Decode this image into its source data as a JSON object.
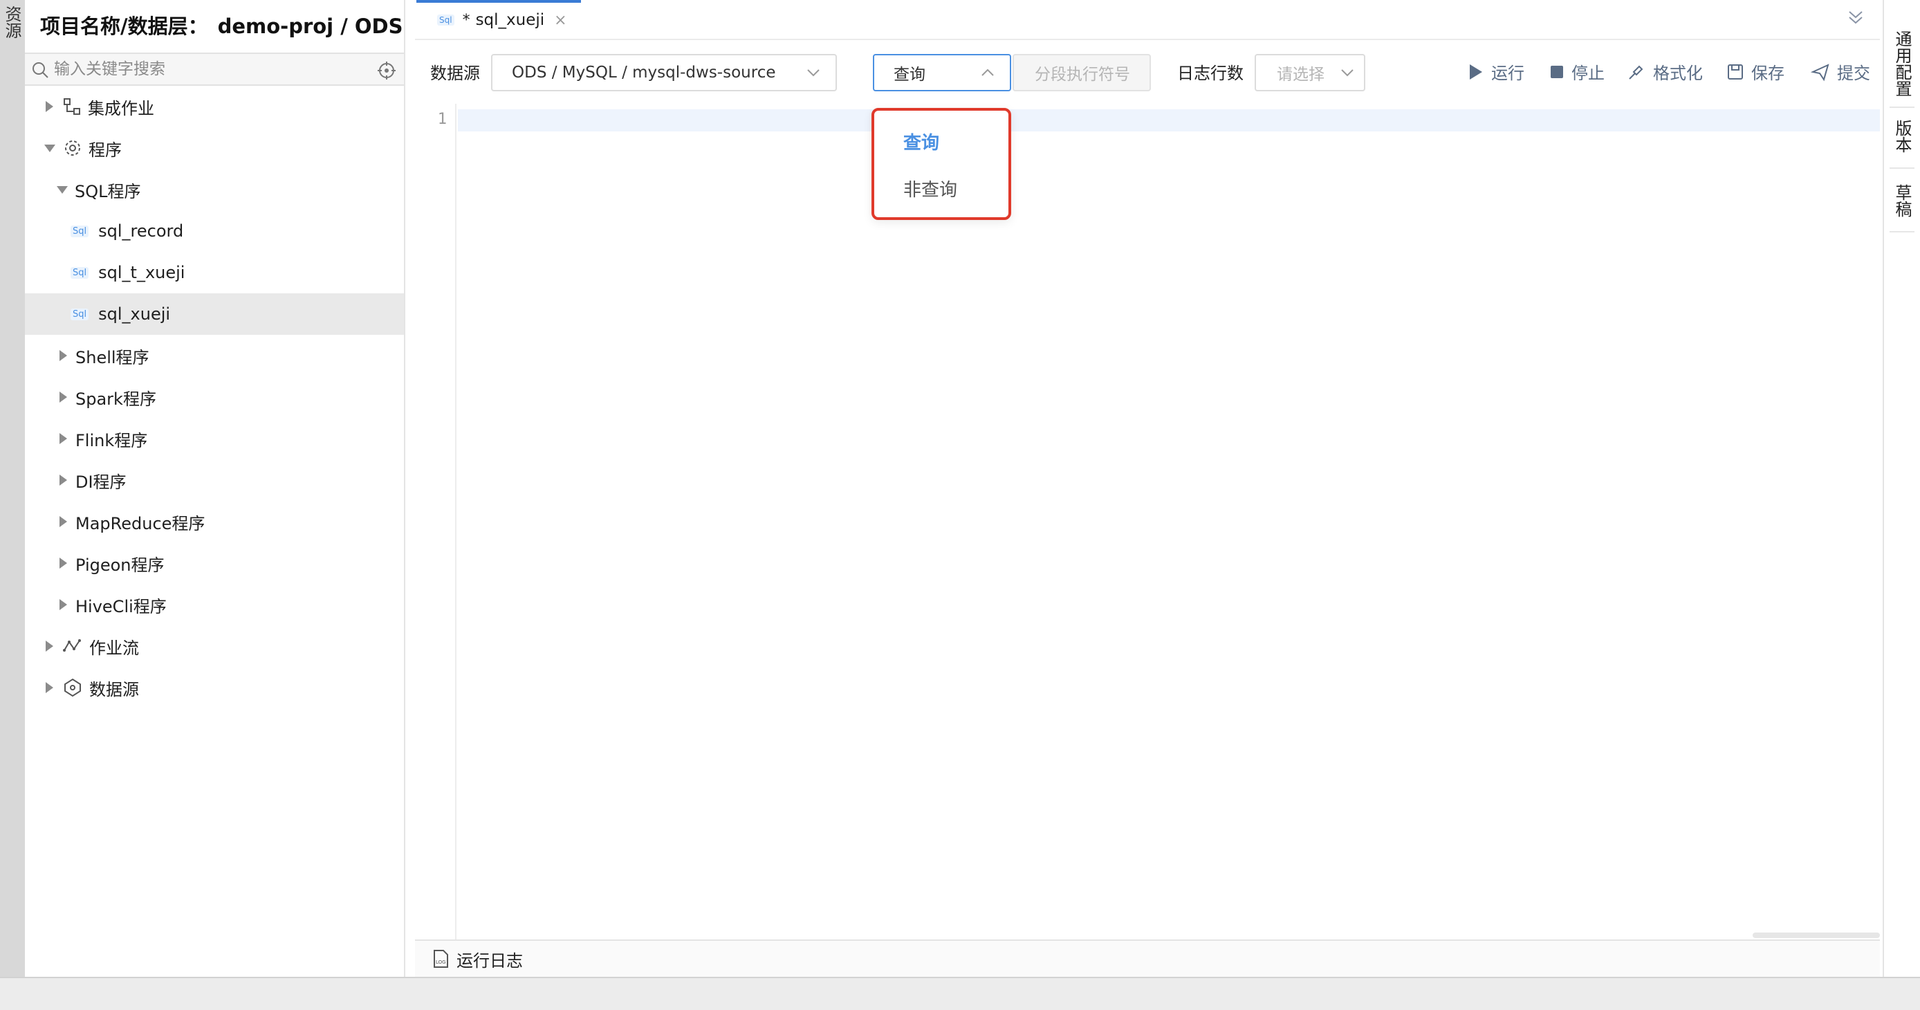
{
  "left_rail": {
    "label": "资源"
  },
  "sidebar": {
    "project_label": "项目名称/数据层：",
    "project_value": "demo-proj / ODS",
    "search_placeholder": "输入关键字搜索",
    "tree": {
      "jobs": "集成作业",
      "programs": "程序",
      "sql_programs": "SQL程序",
      "sql_items": [
        "sql_record",
        "sql_t_xueji",
        "sql_xueji"
      ],
      "sql_badge": "Sql",
      "shell": "Shell程序",
      "spark": "Spark程序",
      "flink": "Flink程序",
      "di": "DI程序",
      "mapreduce": "MapReduce程序",
      "pigeon": "Pigeon程序",
      "hivecli": "HiveCli程序",
      "workflow": "作业流",
      "datasource": "数据源"
    }
  },
  "tab": {
    "badge": "Sql",
    "modified_mark": "*",
    "title": "sql_xueji",
    "close": "×"
  },
  "toolbar": {
    "datasource_label": "数据源",
    "datasource_value": "ODS / MySQL / mysql-dws-source",
    "query_type_value": "查询",
    "separator_placeholder": "分段执行符号",
    "log_rows_label": "日志行数",
    "log_rows_placeholder": "请选择",
    "run": "运行",
    "stop": "停止",
    "format": "格式化",
    "save": "保存",
    "submit": "提交"
  },
  "editor": {
    "line_number": "1"
  },
  "logbar": {
    "label": "运行日志"
  },
  "right_rail": {
    "general_config": "通用配置",
    "version": "版本",
    "draft": "草稿"
  },
  "dropdown": {
    "options": [
      "查询",
      "非查询"
    ],
    "selected": "查询"
  },
  "colors": {
    "accent": "#4a90e2",
    "highlight_border": "#e03a2b"
  }
}
